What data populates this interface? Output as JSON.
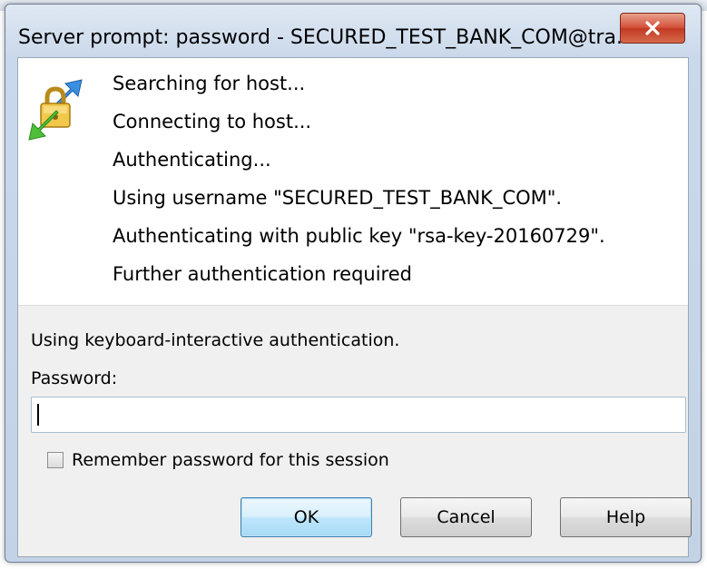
{
  "dialog": {
    "title": "Server prompt: password - SECURED_TEST_BANK_COM@tra...",
    "close_icon": "close-x-icon",
    "app_icon": "secure-transfer-lock-icon"
  },
  "log": {
    "lines": [
      "Searching for host...",
      "Connecting to host...",
      "Authenticating...",
      "Using username \"SECURED_TEST_BANK_COM\".",
      "Authenticating with public key \"rsa-key-20160729\".",
      "Further authentication required"
    ]
  },
  "prompt": {
    "instructions": "Using keyboard-interactive authentication.",
    "password_label": "Password:",
    "password_value": "",
    "remember_label": "Remember password for this session",
    "remember_checked": false
  },
  "buttons": {
    "ok": "OK",
    "cancel": "Cancel",
    "help": "Help"
  },
  "colors": {
    "close_button": "#d4513a",
    "default_button_border": "#3c7fb1"
  }
}
